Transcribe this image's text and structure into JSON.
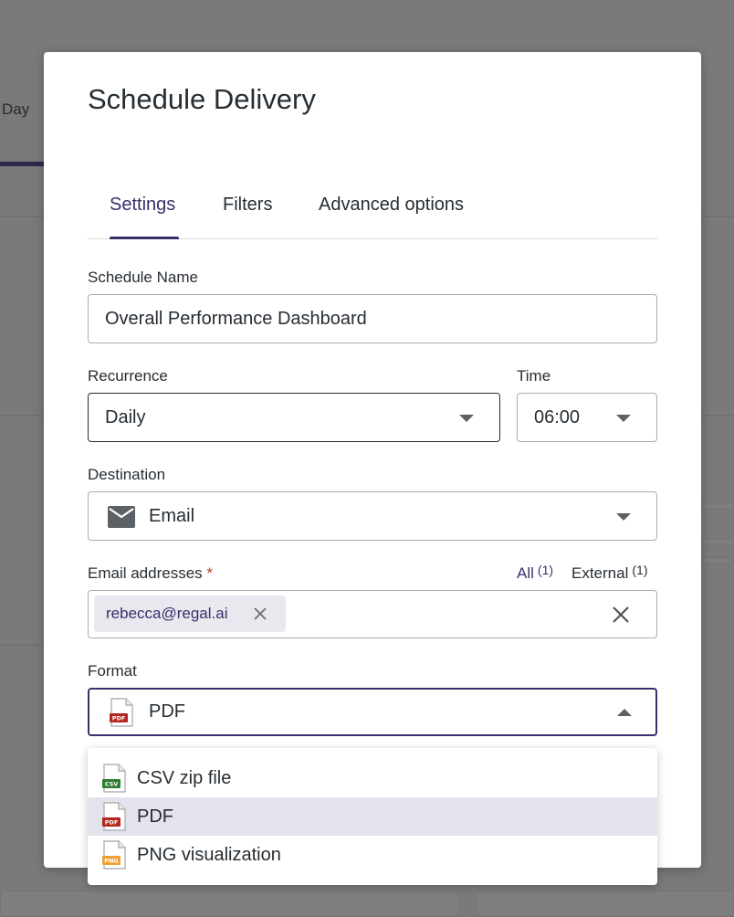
{
  "background": {
    "tab_label": "Day"
  },
  "modal": {
    "title": "Schedule Delivery",
    "tabs": [
      {
        "label": "Settings",
        "active": true
      },
      {
        "label": "Filters",
        "active": false
      },
      {
        "label": "Advanced options",
        "active": false
      }
    ],
    "schedule_name": {
      "label": "Schedule Name",
      "value": "Overall Performance Dashboard"
    },
    "recurrence": {
      "label": "Recurrence",
      "value": "Daily"
    },
    "time": {
      "label": "Time",
      "value": "06:00"
    },
    "destination": {
      "label": "Destination",
      "value": "Email",
      "icon": "envelope-icon"
    },
    "email_addresses": {
      "label": "Email addresses",
      "required_mark": "*",
      "all_label": "All",
      "all_count": "(1)",
      "external_label": "External",
      "external_count": "(1)",
      "chips": [
        "rebecca@regal.ai"
      ]
    },
    "format": {
      "label": "Format",
      "value": "PDF",
      "icon": "pdf-file-icon",
      "options": [
        {
          "label": "CSV zip file",
          "icon": "csv-file-icon",
          "tag": "CSV",
          "color": "#2e7d32"
        },
        {
          "label": "PDF",
          "icon": "pdf-file-icon",
          "tag": "PDF",
          "color": "#b3261e",
          "selected": true
        },
        {
          "label": "PNG visualization",
          "icon": "png-file-icon",
          "tag": "PNG",
          "color": "#f0a030"
        }
      ]
    }
  },
  "colors": {
    "accent": "#3a2f6b",
    "required": "#c0392b",
    "overlay": "#7b7b7b"
  }
}
